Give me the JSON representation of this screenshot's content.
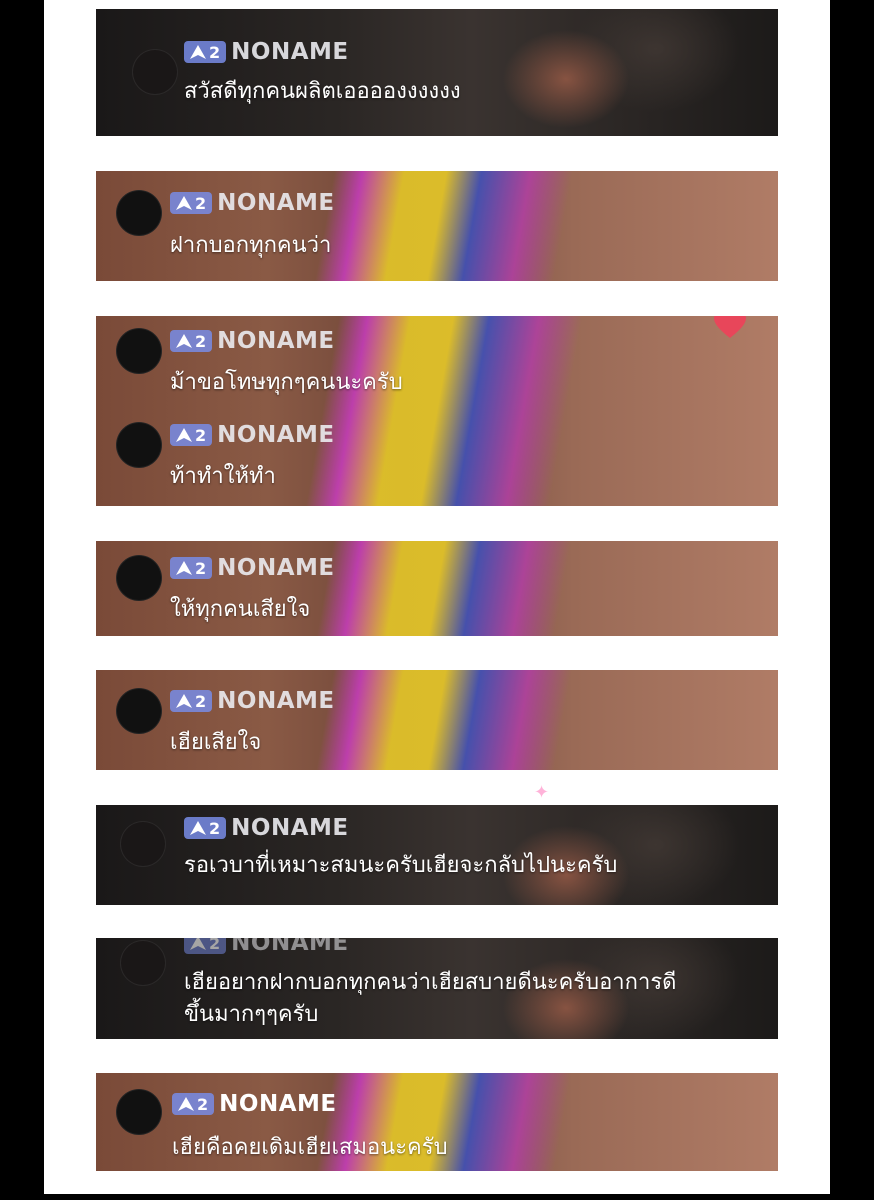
{
  "comments": [
    {
      "username": "NONAME",
      "level": "2",
      "message": "สวัสดีทุกคนผลิตเอออองงงงงง"
    },
    {
      "username": "NONAME",
      "level": "2",
      "message": "ฝากบอกทุกคนว่า"
    },
    {
      "username": "NONAME",
      "level": "2",
      "message": "ม้าขอโทษทุกๆคนนะครับ"
    },
    {
      "username": "NONAME",
      "level": "2",
      "message": "ท้าทำให้ทำ"
    },
    {
      "username": "NONAME",
      "level": "2",
      "message": "ให้ทุกคนเสียใจ"
    },
    {
      "username": "NONAME",
      "level": "2",
      "message": "เฮียเสียใจ"
    },
    {
      "username": "NONAME",
      "level": "2",
      "message": "รอเวบาที่เหมาะสมนะครับเฮียจะกลับไปนะครับ"
    },
    {
      "username": "NONAME",
      "level": "2",
      "message_line1": "เฮียอยากฝากบอกทุกคนว่าเฮียสบายดีนะครับอาการดี",
      "message_line2": "ขึ้นมากๆๆครับ"
    },
    {
      "username": "NONAME",
      "level": "2",
      "message": "เฮียคือคยเดิมเฮียเสมอนะครับ"
    }
  ],
  "icons": {
    "badge": "level-arrow-icon",
    "reaction": "heart-icon",
    "sparkle": "sparkle-icon"
  },
  "colors": {
    "badge_bg": "#7b8ee6",
    "heart": "#e8465a",
    "page_bg": "#ffffff",
    "frame": "#000000"
  }
}
